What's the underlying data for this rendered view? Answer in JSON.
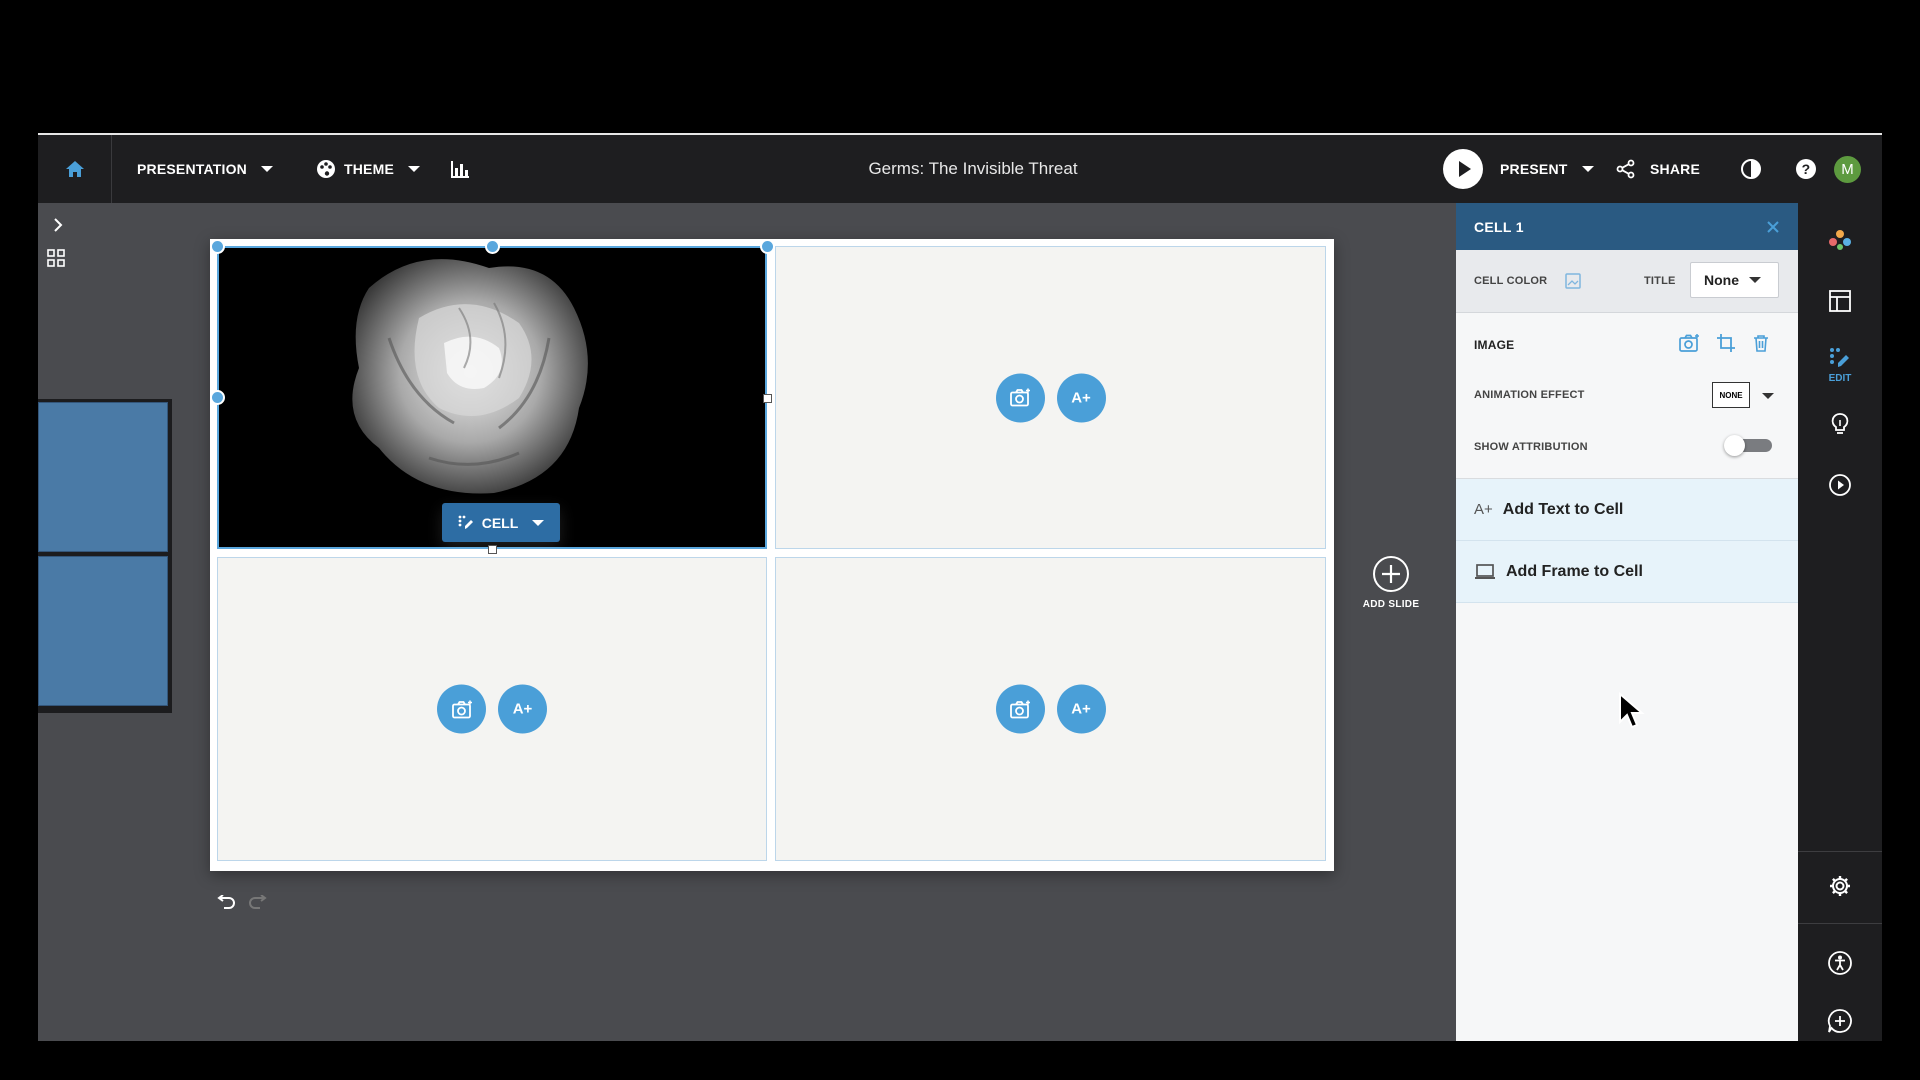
{
  "topbar": {
    "presentation_label": "PRESENTATION",
    "theme_label": "THEME",
    "doc_title": "Germs: The Invisible Threat",
    "present_label": "PRESENT",
    "share_label": "SHARE",
    "avatar_initial": "M"
  },
  "slide": {
    "cell_tag_label": "CELL",
    "text_button_label": "A+",
    "add_slide_label": "ADD SLIDE"
  },
  "panel": {
    "title": "CELL 1",
    "cell_color_label": "CELL COLOR",
    "title_label": "TITLE",
    "title_value": "None",
    "image_label": "IMAGE",
    "animation_label": "ANIMATION EFFECT",
    "animation_value": "NONE",
    "attribution_label": "SHOW ATTRIBUTION",
    "attribution_on": false,
    "add_text_icon": "A+",
    "add_text_label": "Add Text to Cell",
    "add_frame_label": "Add Frame to Cell"
  },
  "rail": {
    "edit_label": "EDIT"
  },
  "colors": {
    "accent": "#4a9fd8",
    "panel_header": "#2a5a82",
    "avatar": "#5d9a3f"
  }
}
